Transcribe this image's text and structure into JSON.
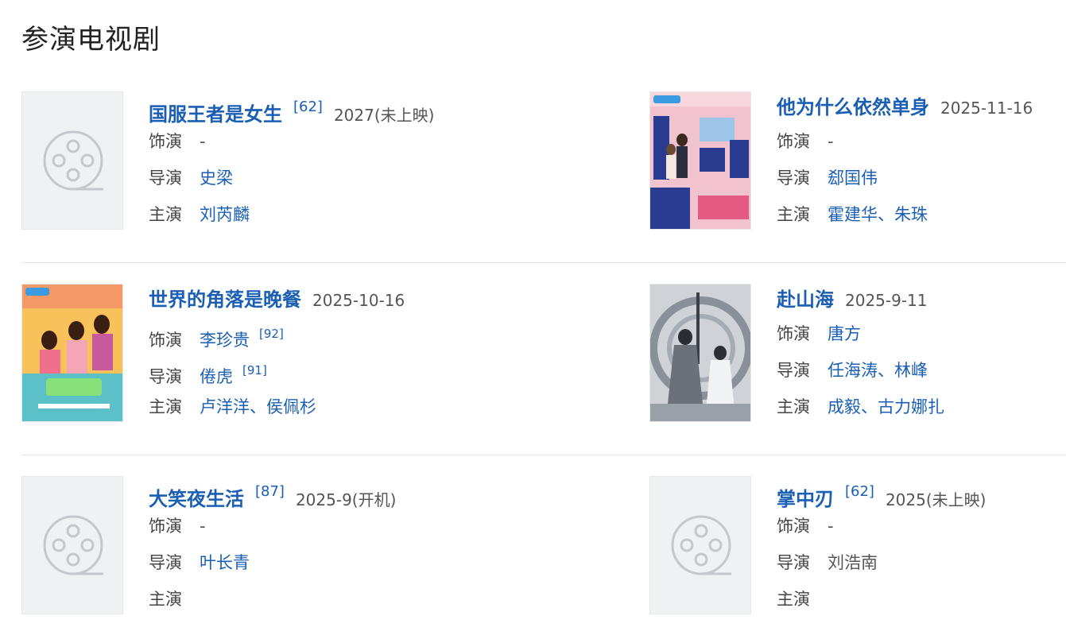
{
  "section_title": "参演电视剧",
  "dramas": [
    {
      "title": "国服王者是女生",
      "score": "[62]",
      "date": "2027(未上映)",
      "labels": {
        "role": "饰演",
        "director": "导演",
        "cast": "主演"
      },
      "role": "-",
      "role_ref": "",
      "director": "史梁",
      "director_ref": "",
      "cast": "刘芮麟",
      "poster": "placeholder-film-icon"
    },
    {
      "title": "他为什么依然单身",
      "score": "",
      "date": "2025-11-16",
      "labels": {
        "role": "饰演",
        "director": "导演",
        "cast": "主演"
      },
      "role": "-",
      "role_ref": "",
      "director": "郄国伟",
      "director_ref": "",
      "cast": "霍建华、朱珠",
      "poster": "poster-image"
    },
    {
      "title": "世界的角落是晚餐",
      "score": "",
      "date": "2025-10-16",
      "labels": {
        "role": "饰演",
        "director": "导演",
        "cast": "主演"
      },
      "role": "李珍贵",
      "role_ref": "[92]",
      "director": "倦虎",
      "director_ref": "[91]",
      "cast": "卢洋洋、侯佩杉",
      "poster": "poster-image"
    },
    {
      "title": "赴山海",
      "score": "",
      "date": "2025-9-11",
      "labels": {
        "role": "饰演",
        "director": "导演",
        "cast": "主演"
      },
      "role": "唐方",
      "role_ref": "",
      "director": "任海涛、林峰",
      "director_ref": "",
      "cast": "成毅、古力娜扎",
      "poster": "poster-image"
    },
    {
      "title": "大笑夜生活",
      "score": "[87]",
      "date": "2025-9(开机)",
      "labels": {
        "role": "饰演",
        "director": "导演",
        "cast": "主演"
      },
      "role": "-",
      "role_ref": "",
      "director": "叶长青",
      "director_ref": "",
      "cast": "",
      "poster": "placeholder-film-icon"
    },
    {
      "title": "掌中刃",
      "score": "[62]",
      "date": "2025(未上映)",
      "labels": {
        "role": "饰演",
        "director": "导演",
        "cast": "主演"
      },
      "role": "-",
      "role_ref": "",
      "director": "刘浩南",
      "director_ref": "",
      "cast": "",
      "poster": "placeholder-film-icon"
    }
  ],
  "colors": {
    "link": "#1a5fb4",
    "text": "#444444",
    "placeholder_bg": "#f0f1f3"
  }
}
